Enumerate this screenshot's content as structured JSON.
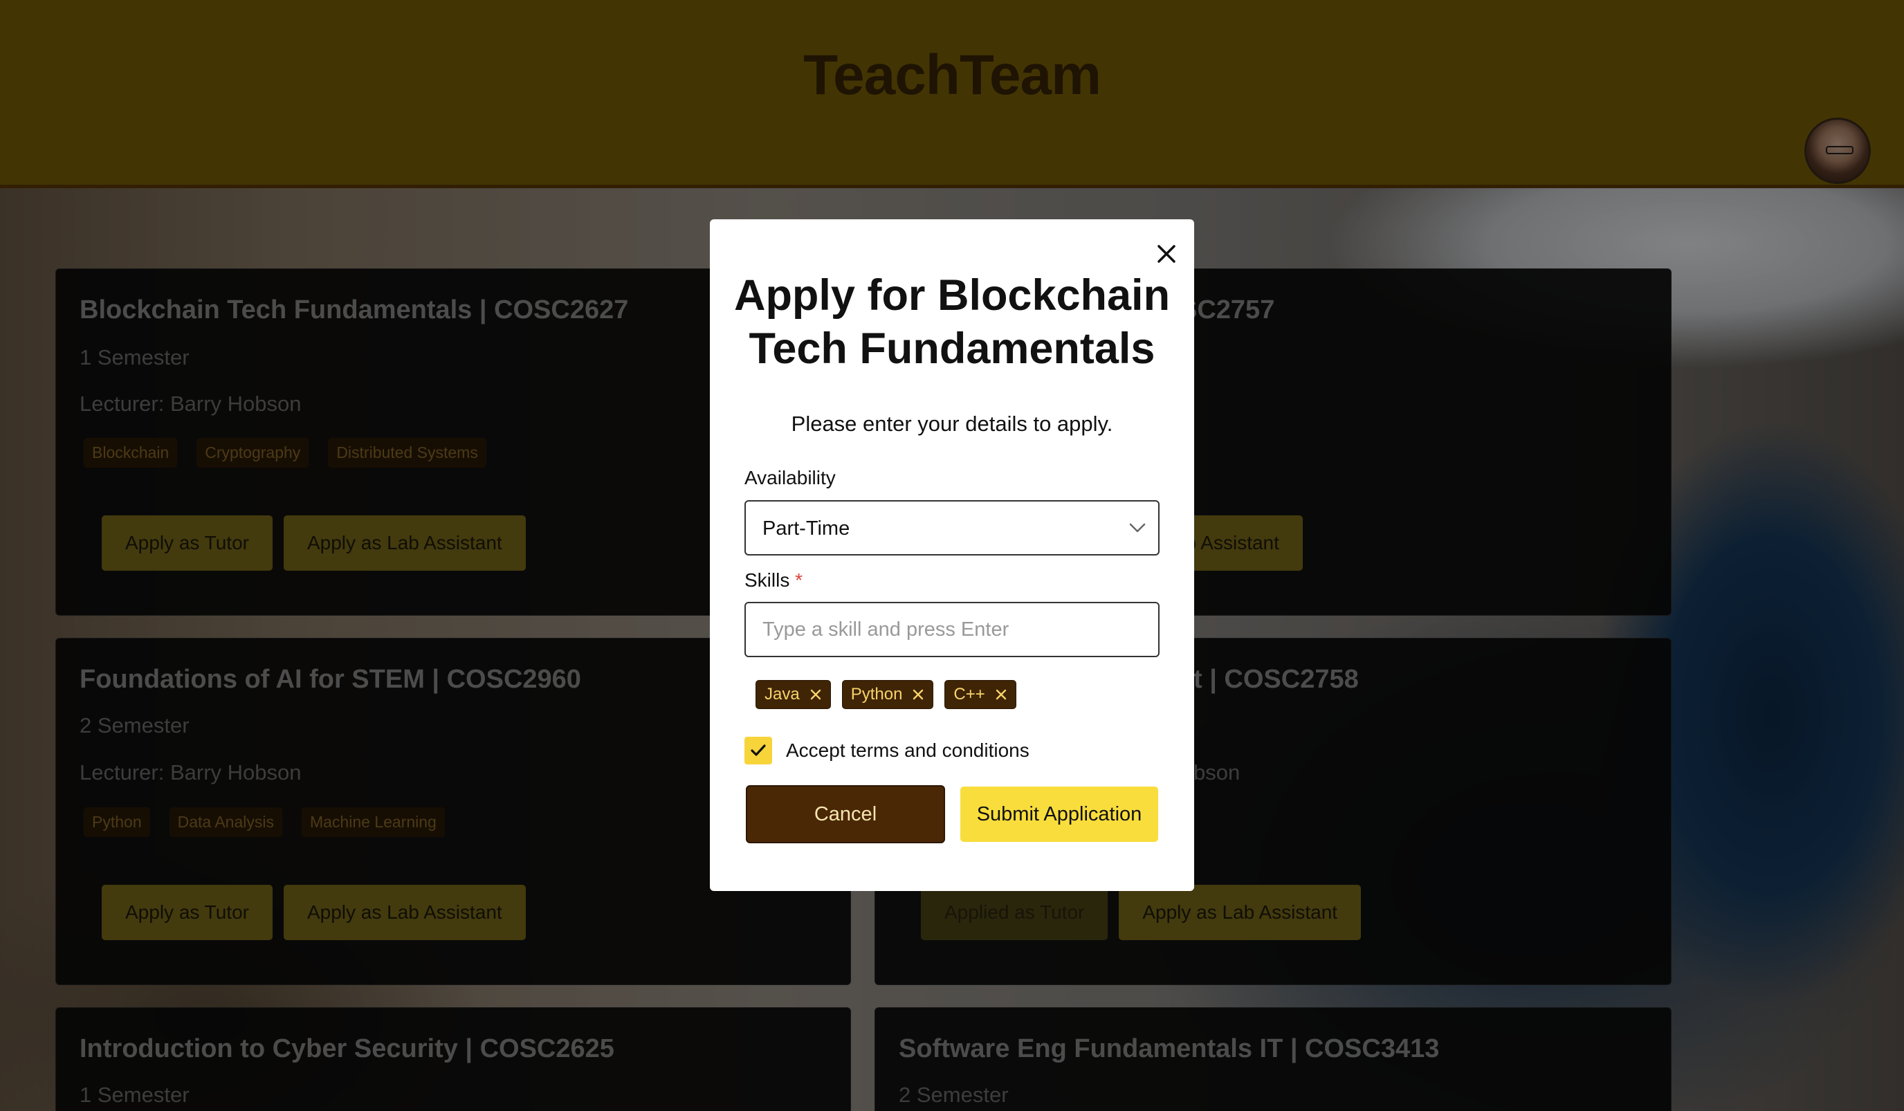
{
  "header": {
    "title": "TeachTeam"
  },
  "courses": [
    {
      "title": "Blockchain Tech Fundamentals | COSC2627",
      "semester": "1 Semester",
      "lecturer": "Lecturer: Barry Hobson",
      "tags": [
        "Blockchain",
        "Cryptography",
        "Distributed Systems"
      ],
      "buttons": [
        "Apply as Tutor",
        "Apply as Lab Assistant"
      ]
    },
    {
      "title_visible": "SC2757",
      "buttons_visible": [
        "as Lab Assistant"
      ]
    },
    {
      "title": "Foundations of AI for STEM | COSC2960",
      "semester": "2 Semester",
      "lecturer": "Lecturer: Barry Hobson",
      "tags": [
        "Python",
        "Data Analysis",
        "Machine Learning"
      ],
      "buttons": [
        "Apply as Tutor",
        "Apply as Lab Assistant"
      ]
    },
    {
      "title_visible": "t | COSC2758",
      "lecturer_visible": "bson",
      "buttons": [
        "Applied as Tutor",
        "Apply as Lab Assistant"
      ]
    },
    {
      "title": "Introduction to Cyber Security | COSC2625",
      "semester": "1 Semester"
    },
    {
      "title": "Software Eng Fundamentals IT | COSC3413",
      "semester": "2 Semester"
    }
  ],
  "modal": {
    "title": "Apply for Blockchain Tech Fundamentals",
    "subtitle": "Please enter your details to apply.",
    "availability_label": "Availability",
    "availability_value": "Part-Time",
    "skills_label": "Skills",
    "required_mark": "*",
    "skills_placeholder": "Type a skill and press Enter",
    "skills": [
      "Java",
      "Python",
      "C++"
    ],
    "terms_label": "Accept terms and conditions",
    "terms_checked": true,
    "cancel_label": "Cancel",
    "submit_label": "Submit Application"
  },
  "colors": {
    "header_bg": "#7a6207",
    "submit_bg": "#f9dd3c",
    "cancel_bg": "#4a2705",
    "chip_bg": "#3f2406"
  }
}
